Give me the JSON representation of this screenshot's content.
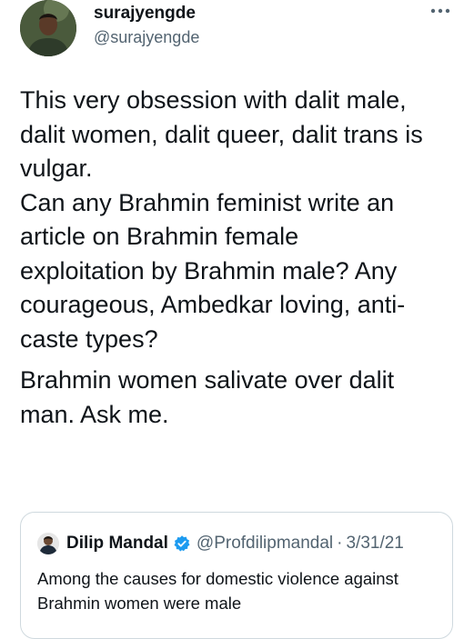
{
  "tweet": {
    "author_name": "surajyengde",
    "author_handle": "@surajyengde",
    "paragraphs": [
      "This very obsession with dalit male,\ndalit women, dalit queer, dalit trans is\nvulgar.\nCan any Brahmin feminist write an\narticle on Brahmin female\nexploitation by Brahmin male? Any\ncourageous, Ambedkar loving, anti-\ncaste types?",
      "Brahmin women salivate over dalit\nman. Ask me."
    ]
  },
  "quoted_tweet": {
    "author_name": "Dilip Mandal",
    "author_handle": "@Profdilipmandal",
    "separator": "·",
    "date": "3/31/21",
    "text": "Among the causes for domestic violence against Brahmin women were male"
  },
  "icons": {
    "more": "more-horizontal-icon",
    "verified": "verified-badge-icon"
  },
  "colors": {
    "text": "#0f1419",
    "secondary": "#536471",
    "border": "#cfd9de",
    "verified": "#1d9bf0"
  }
}
